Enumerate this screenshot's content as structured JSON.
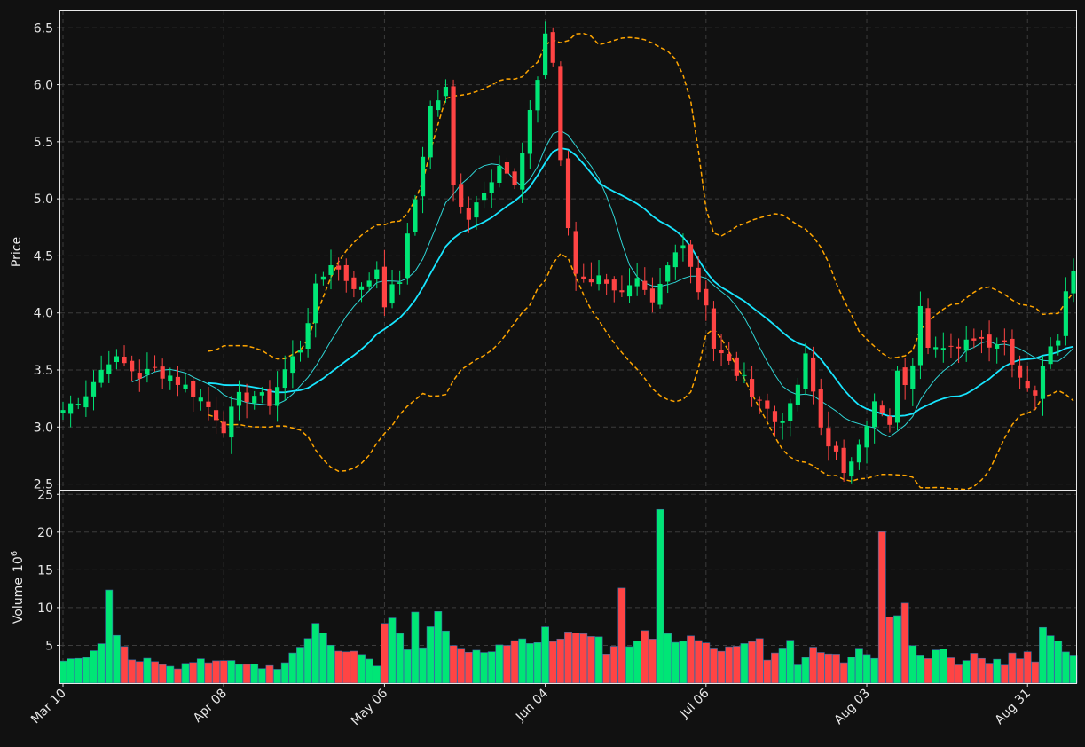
{
  "chart_data": {
    "type": "candlestick",
    "price_panel": {
      "ylabel": "Price",
      "ylim": [
        2.45,
        6.65
      ],
      "yticks": [
        2.5,
        3.0,
        3.5,
        4.0,
        4.5,
        5.0,
        5.5,
        6.0,
        6.5
      ],
      "grid": true
    },
    "volume_panel": {
      "ylabel": "Volume",
      "ylabel_exponent": "10",
      "ylabel_exponent_power": "6",
      "ylim": [
        0,
        25.5
      ],
      "yticks": [
        5,
        10,
        15,
        20,
        25
      ],
      "grid": true
    },
    "x_ticks": [
      {
        "index": 0,
        "label": "Mar 10"
      },
      {
        "index": 21,
        "label": "Apr 08"
      },
      {
        "index": 42,
        "label": "May 06"
      },
      {
        "index": 63,
        "label": "Jun 04"
      },
      {
        "index": 84,
        "label": "Jul 06"
      },
      {
        "index": 105,
        "label": "Aug 03"
      },
      {
        "index": 126,
        "label": "Aug 31"
      }
    ],
    "bar_count": 133,
    "colors": {
      "background": "#111111",
      "up": "#00e676",
      "down": "#ff4444",
      "ma_fast": "#2fd6d6",
      "ma_slow": "#18e6ff",
      "bollinger": "#ffa500",
      "frame": "#e8e8e8"
    },
    "anchors": {
      "close": [
        [
          0,
          3.15
        ],
        [
          3,
          3.3
        ],
        [
          6,
          3.6
        ],
        [
          8,
          3.55
        ],
        [
          10,
          3.45
        ],
        [
          12,
          3.5
        ],
        [
          14,
          3.45
        ],
        [
          16,
          3.35
        ],
        [
          18,
          3.25
        ],
        [
          20,
          3.1
        ],
        [
          21,
          3.0
        ],
        [
          23,
          3.25
        ],
        [
          25,
          3.28
        ],
        [
          27,
          3.22
        ],
        [
          29,
          3.5
        ],
        [
          31,
          3.7
        ],
        [
          33,
          4.2
        ],
        [
          35,
          4.45
        ],
        [
          37,
          4.3
        ],
        [
          39,
          4.2
        ],
        [
          41,
          4.4
        ],
        [
          42,
          4.1
        ],
        [
          44,
          4.3
        ],
        [
          46,
          5.0
        ],
        [
          48,
          5.8
        ],
        [
          50,
          5.95
        ],
        [
          51,
          5.1
        ],
        [
          53,
          4.85
        ],
        [
          55,
          5.1
        ],
        [
          57,
          5.3
        ],
        [
          59,
          5.1
        ],
        [
          60,
          5.35
        ],
        [
          61,
          5.8
        ],
        [
          62,
          6.05
        ],
        [
          63,
          6.45
        ],
        [
          64,
          6.2
        ],
        [
          65,
          5.3
        ],
        [
          66,
          4.75
        ],
        [
          67,
          4.35
        ],
        [
          69,
          4.3
        ],
        [
          71,
          4.3
        ],
        [
          73,
          4.15
        ],
        [
          75,
          4.25
        ],
        [
          77,
          4.05
        ],
        [
          79,
          4.4
        ],
        [
          81,
          4.65
        ],
        [
          83,
          4.2
        ],
        [
          84,
          4.1
        ],
        [
          85,
          3.7
        ],
        [
          87,
          3.55
        ],
        [
          89,
          3.4
        ],
        [
          91,
          3.25
        ],
        [
          93,
          3.05
        ],
        [
          95,
          3.15
        ],
        [
          97,
          3.6
        ],
        [
          99,
          3.0
        ],
        [
          101,
          2.75
        ],
        [
          102,
          2.55
        ],
        [
          104,
          2.9
        ],
        [
          106,
          3.2
        ],
        [
          108,
          3.0
        ],
        [
          109,
          3.45
        ],
        [
          110,
          3.4
        ],
        [
          111,
          3.5
        ],
        [
          112,
          4.1
        ],
        [
          113,
          3.75
        ],
        [
          115,
          3.75
        ],
        [
          117,
          3.65
        ],
        [
          119,
          3.8
        ],
        [
          121,
          3.75
        ],
        [
          123,
          3.75
        ],
        [
          125,
          3.45
        ],
        [
          127,
          3.3
        ],
        [
          128,
          3.5
        ],
        [
          129,
          3.75
        ],
        [
          130,
          3.8
        ],
        [
          131,
          4.25
        ],
        [
          132,
          4.35
        ]
      ],
      "volume": [
        [
          0,
          3.2
        ],
        [
          3,
          3.6
        ],
        [
          5,
          5.5
        ],
        [
          6,
          12.6
        ],
        [
          7,
          6.5
        ],
        [
          9,
          3.2
        ],
        [
          12,
          3.1
        ],
        [
          15,
          2.2
        ],
        [
          18,
          3.2
        ],
        [
          21,
          2.7
        ],
        [
          25,
          2.4
        ],
        [
          28,
          1.8
        ],
        [
          30,
          4.0
        ],
        [
          32,
          6.2
        ],
        [
          33,
          7.8
        ],
        [
          36,
          4.0
        ],
        [
          39,
          3.9
        ],
        [
          41,
          2.2
        ],
        [
          42,
          7.7
        ],
        [
          43,
          8.3
        ],
        [
          45,
          4.5
        ],
        [
          46,
          9.1
        ],
        [
          47,
          4.5
        ],
        [
          48,
          7.3
        ],
        [
          49,
          9.1
        ],
        [
          50,
          7.3
        ],
        [
          51,
          5.3
        ],
        [
          53,
          3.7
        ],
        [
          56,
          4.5
        ],
        [
          59,
          5.5
        ],
        [
          62,
          5.6
        ],
        [
          63,
          7.2
        ],
        [
          64,
          5.8
        ],
        [
          66,
          6.5
        ],
        [
          70,
          6.1
        ],
        [
          71,
          3.7
        ],
        [
          72,
          5.2
        ],
        [
          73,
          12.4
        ],
        [
          74,
          5.1
        ],
        [
          76,
          6.7
        ],
        [
          77,
          5.7
        ],
        [
          78,
          23.4
        ],
        [
          79,
          6.8
        ],
        [
          80,
          5.3
        ],
        [
          82,
          6.4
        ],
        [
          84,
          5.0
        ],
        [
          86,
          4.2
        ],
        [
          91,
          6.2
        ],
        [
          92,
          3.3
        ],
        [
          95,
          5.6
        ],
        [
          96,
          2.8
        ],
        [
          98,
          4.4
        ],
        [
          101,
          3.7
        ],
        [
          102,
          2.4
        ],
        [
          104,
          4.9
        ],
        [
          105,
          3.4
        ],
        [
          106,
          3.6
        ],
        [
          107,
          19.8
        ],
        [
          108,
          9.1
        ],
        [
          109,
          9.0
        ],
        [
          110,
          10.9
        ],
        [
          111,
          4.9
        ],
        [
          112,
          3.6
        ],
        [
          113,
          3.3
        ],
        [
          115,
          4.8
        ],
        [
          117,
          2.4
        ],
        [
          119,
          3.7
        ],
        [
          121,
          2.4
        ],
        [
          122,
          3.0
        ],
        [
          123,
          2.7
        ],
        [
          124,
          3.8
        ],
        [
          125,
          3.4
        ],
        [
          126,
          3.8
        ],
        [
          127,
          2.7
        ],
        [
          128,
          7.0
        ],
        [
          132,
          3.5
        ]
      ]
    }
  }
}
